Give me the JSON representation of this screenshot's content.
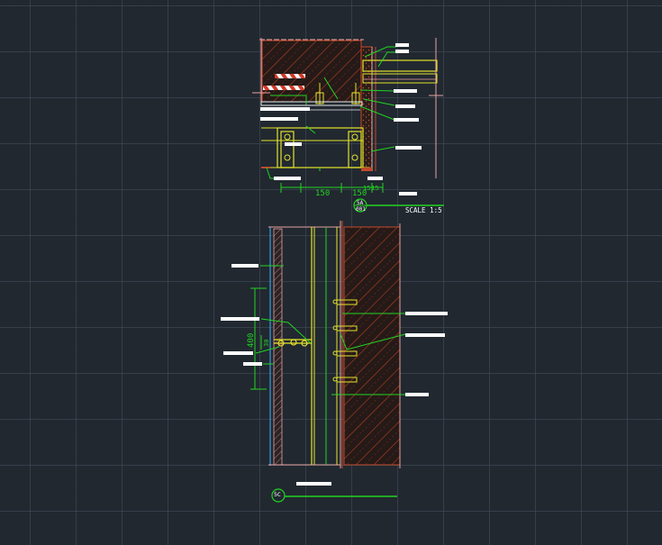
{
  "drawing": {
    "background_color": "#212830",
    "colors": {
      "green": "#22d322",
      "yellow": "#e3e32a",
      "red": "#c24a2a",
      "white": "#ffffff",
      "cyan": "#39b4ff",
      "pink": "#e8a2a2"
    },
    "detail_a": {
      "dimensions": [
        "150",
        "150",
        "15",
        "15"
      ],
      "marker_top": "5A",
      "marker_bottom": "001",
      "scale_label": "SCALE 1:5"
    },
    "detail_b": {
      "dimension_vertical": "400",
      "dimension_small": "30",
      "marker": "5C"
    }
  }
}
